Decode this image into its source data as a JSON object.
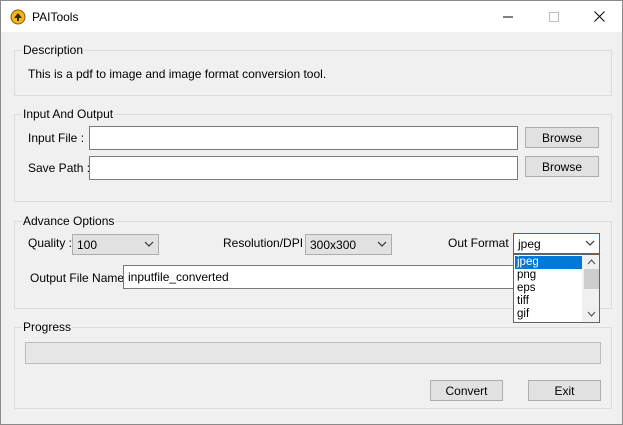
{
  "window": {
    "title": "PAITools",
    "app_icon": "paitools-app-icon",
    "controls": {
      "minimize": "minimize-icon",
      "maximize": "maximize-icon",
      "close": "close-icon"
    }
  },
  "description": {
    "group_label": "Description",
    "text": "This is a pdf to image and image format conversion tool."
  },
  "io": {
    "group_label": "Input And Output",
    "input_label": "Input  File :",
    "input_value": "",
    "save_label": "Save Path :",
    "save_value": "",
    "browse_label": "Browse"
  },
  "advance": {
    "group_label": "Advance Options",
    "quality_label": "Quality :",
    "quality_value": "100",
    "resolution_label": "Resolution/DPI :",
    "resolution_value": "300x300",
    "format_label": "Out Format :",
    "format_value": "jpeg",
    "format_options": [
      "jpeg",
      "png",
      "eps",
      "tiff",
      "gif"
    ],
    "output_name_label": "Output File Name :",
    "output_name_value": "inputfile_converted"
  },
  "progress": {
    "group_label": "Progress",
    "fraction": 0
  },
  "actions": {
    "convert_label": "Convert",
    "exit_label": "Exit"
  },
  "colors": {
    "selection": "#0078d7",
    "window_bg": "#f0f0f0",
    "progress_fill": "#06b025"
  }
}
